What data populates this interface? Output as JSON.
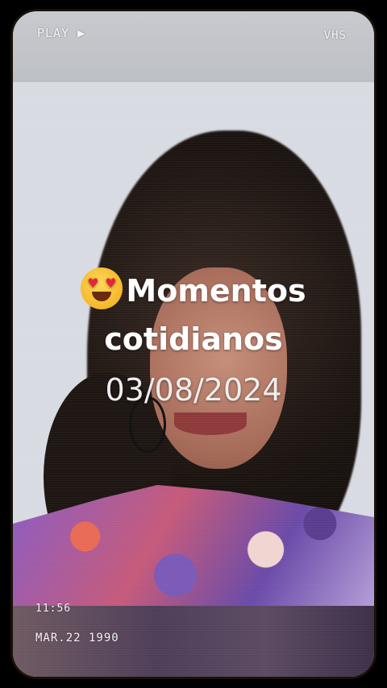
{
  "hud": {
    "play_label": "PLAY ▶",
    "format_label": "VHS",
    "time": "11:56",
    "date_stamp": "MAR.22 1990"
  },
  "caption": {
    "emoji": "heart-eyes-emoji",
    "line1": "Momentos",
    "line2": "cotidianos",
    "line3": "03/08/2024"
  },
  "colors": {
    "caption_text": "#ffffff",
    "frame_border": "#1a1208"
  }
}
